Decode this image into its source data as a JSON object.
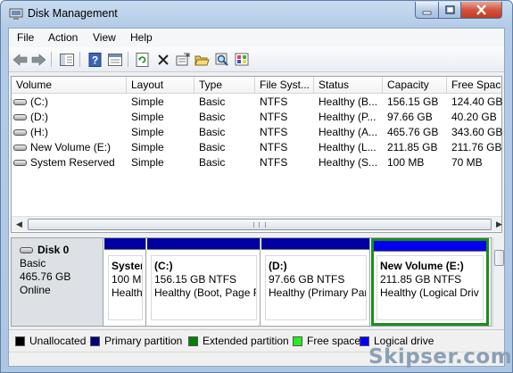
{
  "window": {
    "title": "Disk Management"
  },
  "menu": [
    "File",
    "Action",
    "View",
    "Help"
  ],
  "table": {
    "columns": [
      "Volume",
      "Layout",
      "Type",
      "File Syst...",
      "Status",
      "Capacity",
      "Free Space"
    ],
    "rows": [
      [
        "(C:)",
        "Simple",
        "Basic",
        "NTFS",
        "Healthy (B...",
        "156.15 GB",
        "124.40 GB"
      ],
      [
        "(D:)",
        "Simple",
        "Basic",
        "NTFS",
        "Healthy (P...",
        "97.66 GB",
        "40.20 GB"
      ],
      [
        "(H:)",
        "Simple",
        "Basic",
        "NTFS",
        "Healthy (A...",
        "465.76 GB",
        "343.60 GB"
      ],
      [
        "New Volume (E:)",
        "Simple",
        "Basic",
        "NTFS",
        "Healthy (L...",
        "211.85 GB",
        "211.76 GB"
      ],
      [
        "System Reserved",
        "Simple",
        "Basic",
        "NTFS",
        "Healthy (S...",
        "100 MB",
        "70 MB"
      ]
    ]
  },
  "disk": {
    "name": "Disk 0",
    "type": "Basic",
    "size": "465.76 GB",
    "status": "Online",
    "partitions": [
      {
        "name": "Syster",
        "size": "100 M",
        "status": "Health"
      },
      {
        "name": "(C:)",
        "size": "156.15 GB NTFS",
        "status": "Healthy (Boot, Page F"
      },
      {
        "name": "(D:)",
        "size": "97.66 GB NTFS",
        "status": "Healthy (Primary Par"
      },
      {
        "name": "New Volume  (E:)",
        "size": "211.85 GB NTFS",
        "status": "Healthy (Logical Driv"
      }
    ]
  },
  "legend": [
    {
      "label": "Unallocated",
      "color": "#000000"
    },
    {
      "label": "Primary partition",
      "color": "#000080"
    },
    {
      "label": "Extended partition",
      "color": "#008000"
    },
    {
      "label": "Free space",
      "color": "#22ee22"
    },
    {
      "label": "Logical drive",
      "color": "#0000ff"
    }
  ],
  "watermark": "Skipser.com"
}
